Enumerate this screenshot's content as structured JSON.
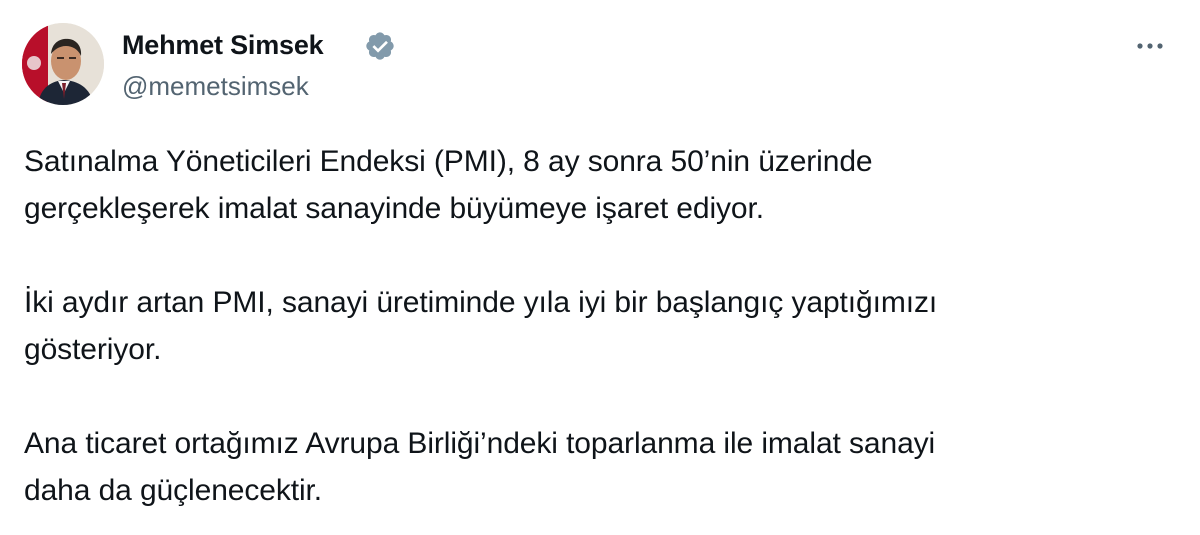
{
  "tweet": {
    "author": {
      "display_name": "Mehmet Simsek",
      "handle": "@memetsimsek",
      "verified": true,
      "avatar_icon": "profile-photo",
      "verified_icon": "verified-badge-icon",
      "verified_color": "#829aab"
    },
    "menu_icon": "more-horizontal-icon",
    "paragraphs": [
      "Satınalma Yöneticileri Endeksi (PMI), 8 ay sonra 50’nin üzerinde\ngerçekleşerek imalat sanayinde büyümeye işaret ediyor.",
      "İki aydır artan PMI, sanayi üretiminde yıla iyi bir başlangıç yaptığımızı\ngösteriyor.",
      "Ana ticaret ortağımız Avrupa Birliği’ndeki toparlanma ile imalat sanayi\ndaha da güçlenecektir."
    ]
  }
}
